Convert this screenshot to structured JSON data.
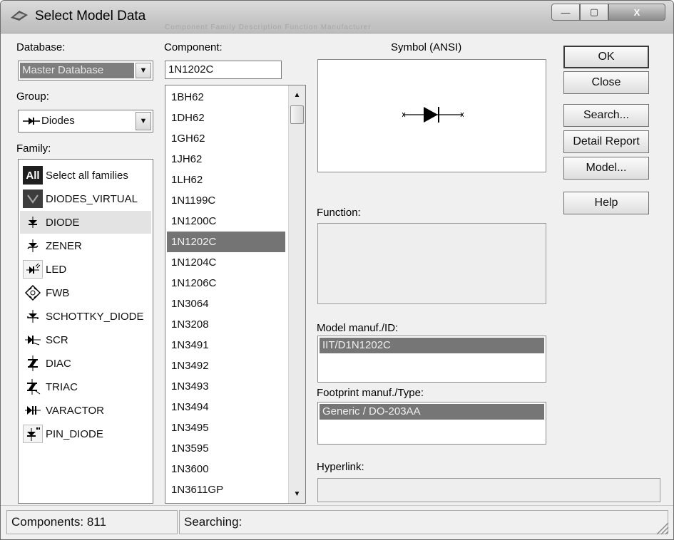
{
  "window": {
    "title": "Select Model Data",
    "title_background_text": "Component  Family  Description  Function  Manufacturer",
    "minimize_glyph": "—",
    "maximize_glyph": "▢",
    "close_glyph": "X"
  },
  "database": {
    "label": "Database:",
    "value": "Master Database"
  },
  "group": {
    "label": "Group:",
    "value": "Diodes",
    "icon": "diode-group-icon"
  },
  "family": {
    "label": "Family:",
    "items": [
      {
        "label": "Select all families",
        "icon": "all-icon",
        "icon_text": "All",
        "selected": false
      },
      {
        "label": "DIODES_VIRTUAL",
        "icon": "virtual-diode-icon",
        "selected": false
      },
      {
        "label": "DIODE",
        "icon": "diode-icon",
        "selected": true
      },
      {
        "label": "ZENER",
        "icon": "zener-icon",
        "selected": false
      },
      {
        "label": "LED",
        "icon": "led-icon",
        "selected": false
      },
      {
        "label": "FWB",
        "icon": "bridge-rectifier-icon",
        "selected": false
      },
      {
        "label": "SCHOTTKY_DIODE",
        "icon": "schottky-icon",
        "selected": false
      },
      {
        "label": "SCR",
        "icon": "scr-icon",
        "selected": false
      },
      {
        "label": "DIAC",
        "icon": "diac-icon",
        "selected": false
      },
      {
        "label": "TRIAC",
        "icon": "triac-icon",
        "selected": false
      },
      {
        "label": "VARACTOR",
        "icon": "varactor-icon",
        "selected": false
      },
      {
        "label": "PIN_DIODE",
        "icon": "pin-diode-icon",
        "selected": false
      }
    ]
  },
  "component": {
    "label": "Component:",
    "value": "1N1202C",
    "items": [
      "1BH62",
      "1DH62",
      "1GH62",
      "1JH62",
      "1LH62",
      "1N1199C",
      "1N1200C",
      "1N1202C",
      "1N1204C",
      "1N1206C",
      "1N3064",
      "1N3208",
      "1N3491",
      "1N3492",
      "1N3493",
      "1N3494",
      "1N3495",
      "1N3595",
      "1N3600",
      "1N3611GP"
    ],
    "selected": "1N1202C"
  },
  "symbol": {
    "label": "Symbol (ANSI)",
    "icon": "diode-symbol-icon"
  },
  "function": {
    "label": "Function:",
    "value": ""
  },
  "model": {
    "label": "Model manuf./ID:",
    "value": "IIT/D1N1202C"
  },
  "footprint": {
    "label": "Footprint manuf./Type:",
    "value": "Generic / DO-203AA"
  },
  "hyperlink": {
    "label": "Hyperlink:",
    "value": ""
  },
  "buttons": {
    "ok": "OK",
    "close": "Close",
    "search": "Search...",
    "detail_report": "Detail Report",
    "model": "Model...",
    "help": "Help"
  },
  "status": {
    "components": "Components: 811",
    "searching": "Searching:"
  }
}
